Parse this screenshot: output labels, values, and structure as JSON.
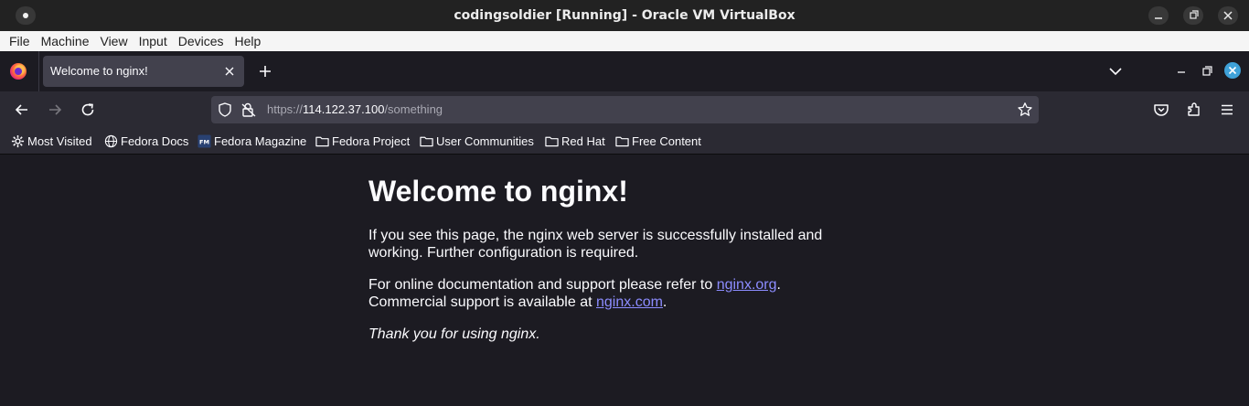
{
  "vbox": {
    "title": "codingsoldier [Running] - Oracle VM VirtualBox",
    "menu": [
      "File",
      "Machine",
      "View",
      "Input",
      "Devices",
      "Help"
    ]
  },
  "firefox": {
    "tab": {
      "label": "Welcome to nginx!"
    },
    "url": {
      "scheme": "https://",
      "host": "114.122.37.100",
      "path": "/something"
    },
    "bookmarks": [
      {
        "label": "Most Visited",
        "icon": "gear-icon"
      },
      {
        "label": "Fedora Docs",
        "icon": "globe-icon"
      },
      {
        "label": "Fedora Magazine",
        "icon": "fedora-magazine-icon"
      },
      {
        "label": "Fedora Project",
        "icon": "folder-icon"
      },
      {
        "label": "User Communities",
        "icon": "folder-icon"
      },
      {
        "label": "Red Hat",
        "icon": "folder-icon"
      },
      {
        "label": "Free Content",
        "icon": "folder-icon"
      }
    ]
  },
  "page": {
    "heading": "Welcome to nginx!",
    "p1": "If you see this page, the nginx web server is successfully installed and working. Further configuration is required.",
    "p2_text1": "For online documentation and support please refer to ",
    "p2_link1": "nginx.org",
    "p2_text2": ".",
    "p2_text3": "Commercial support is available at ",
    "p2_link2": "nginx.com",
    "p2_text4": ".",
    "p3": "Thank you for using nginx."
  },
  "colors": {
    "page_bg": "#1c1b22",
    "toolbar_bg": "#2b2a33",
    "link": "#8c8cff",
    "accent": "#3fa2d9"
  }
}
